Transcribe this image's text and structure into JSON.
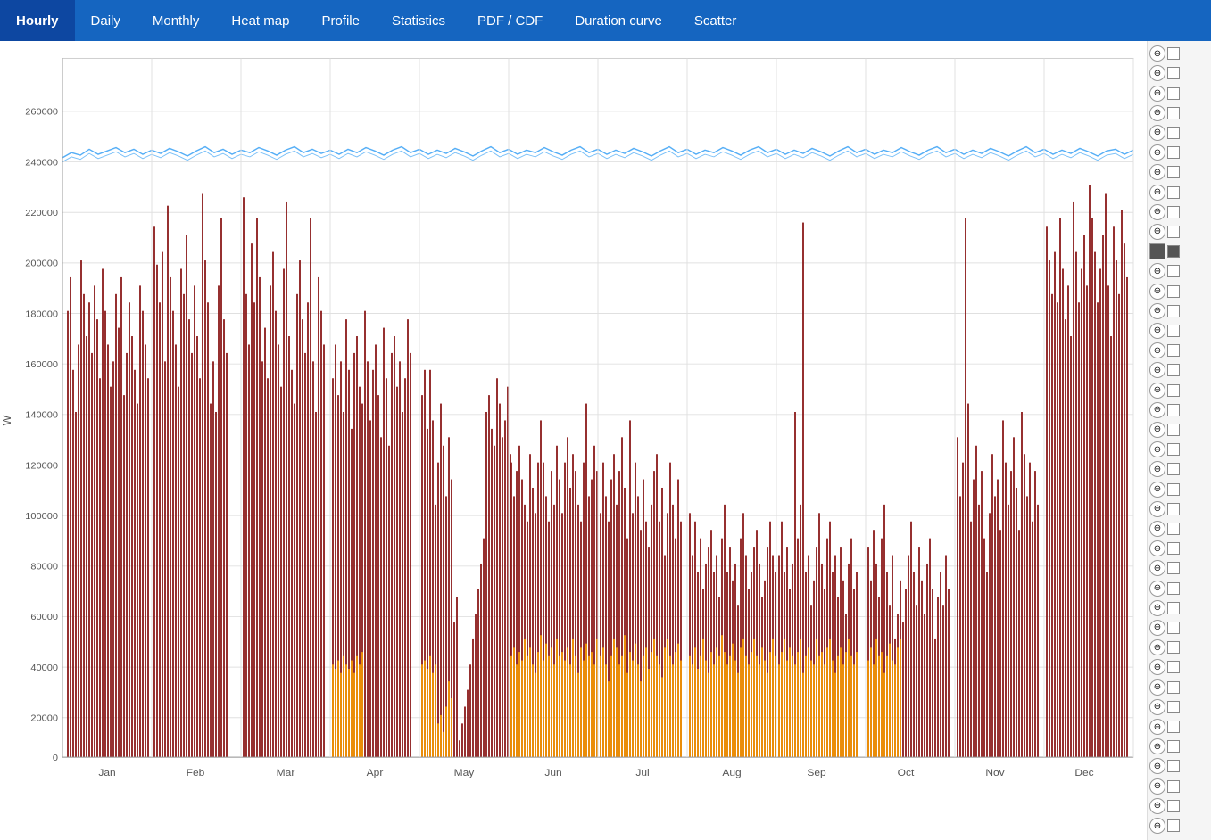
{
  "nav": {
    "items": [
      {
        "label": "Hourly",
        "active": true
      },
      {
        "label": "Daily",
        "active": false
      },
      {
        "label": "Monthly",
        "active": false
      },
      {
        "label": "Heat map",
        "active": false
      },
      {
        "label": "Profile",
        "active": false
      },
      {
        "label": "Statistics",
        "active": false
      },
      {
        "label": "PDF / CDF",
        "active": false
      },
      {
        "label": "Duration curve",
        "active": false
      },
      {
        "label": "Scatter",
        "active": false
      }
    ]
  },
  "chart": {
    "y_axis_label": "W",
    "y_ticks": [
      "260000",
      "240000",
      "220000",
      "200000",
      "180000",
      "160000",
      "140000",
      "120000",
      "100000",
      "80000",
      "60000",
      "40000",
      "20000",
      "0"
    ],
    "x_ticks": [
      "Jan",
      "Feb",
      "Mar",
      "Apr",
      "May",
      "Jun",
      "Jul",
      "Aug",
      "Sep",
      "Oct",
      "Nov",
      "Dec"
    ]
  },
  "colors": {
    "nav_bg": "#1565c0",
    "nav_active": "#0d47a1",
    "bar_red": "#8B1A1A",
    "bar_orange": "#FFA500",
    "line_blue": "#42A5F5"
  },
  "right_panel": {
    "rows": 40
  }
}
